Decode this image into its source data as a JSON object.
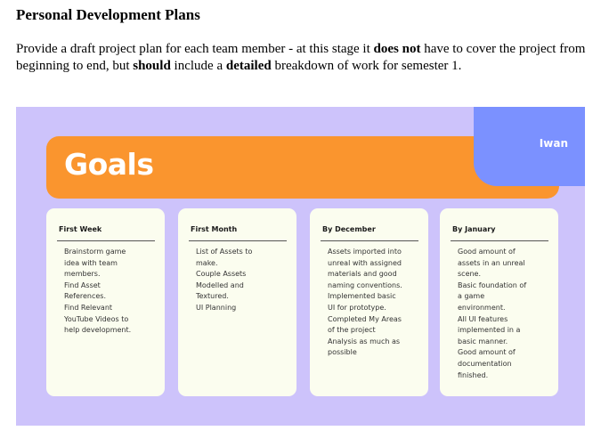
{
  "heading": "Personal Development Plans",
  "paragraph": {
    "p1": "Provide a draft project plan for each team member - at this stage it ",
    "b1": "does not",
    "p2": " have to cover the project from beginning to end, but ",
    "b2": "should",
    "p3": " include a ",
    "b3": "detailed",
    "p4": " breakdown of work for semester 1."
  },
  "slide": {
    "title": "Goals",
    "name": "Iwan",
    "colors": {
      "background": "#cdc3fb",
      "title_bar": "#fa952e",
      "name_box": "#7b91ff",
      "card": "#fbfdef"
    },
    "cards": [
      {
        "title": "First Week",
        "body": "Brainstorm game\nidea with team\nmembers.\nFind Asset\nReferences.\nFind Relevant\nYouTube Videos to\nhelp development."
      },
      {
        "title": "First Month",
        "body": "List of Assets to\nmake.\nCouple Assets\nModelled and\nTextured.\nUI Planning"
      },
      {
        "title": "By December",
        "body": "Assets imported into\nunreal with assigned\nmaterials and good\nnaming conventions.\nImplemented basic\nUI for prototype.\nCompleted My Areas\nof the project\nAnalysis as much as\npossible"
      },
      {
        "title": "By January",
        "body": "Good amount of\nassets in an unreal\nscene.\nBasic foundation of\na game\nenvironment.\nAll UI features\nimplemented in a\nbasic manner.\nGood amount of\ndocumentation\nfinished."
      }
    ]
  }
}
